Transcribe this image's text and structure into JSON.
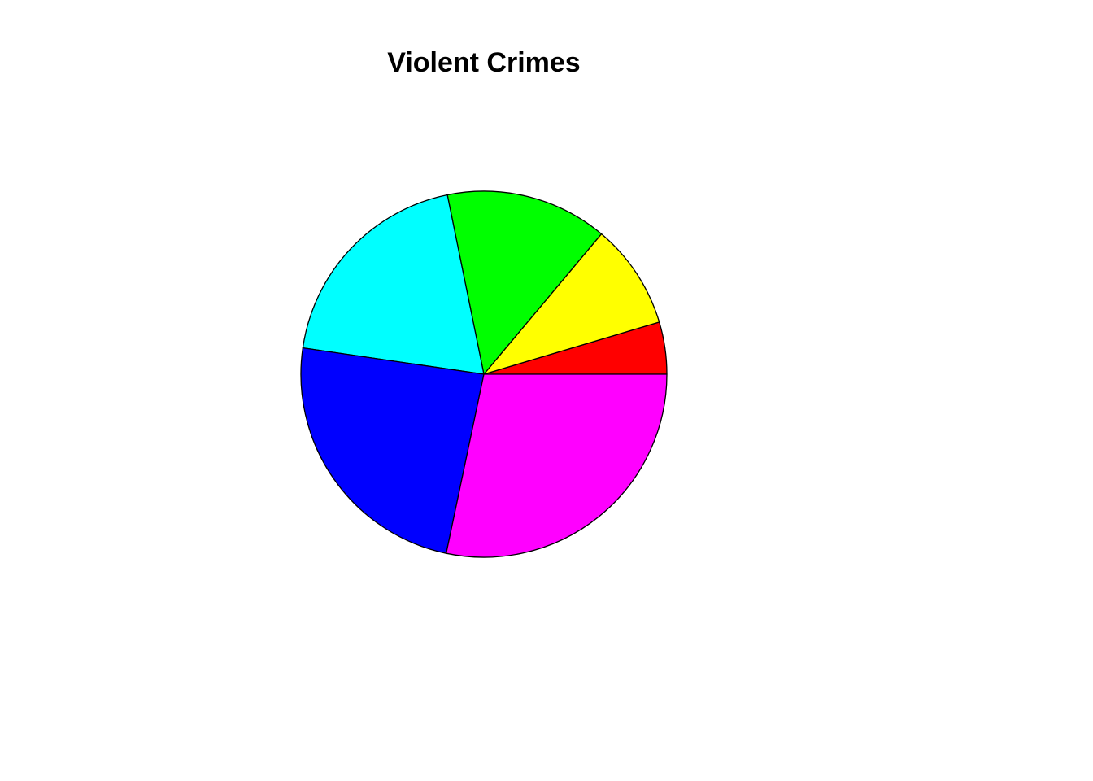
{
  "chart_data": {
    "type": "pie",
    "title": "Violent Crimes",
    "slices": [
      {
        "value": 4.6,
        "color": "#FF0000"
      },
      {
        "value": 9.3,
        "color": "#FFFF00"
      },
      {
        "value": 14.3,
        "color": "#00FF00"
      },
      {
        "value": 19.5,
        "color": "#00FFFF"
      },
      {
        "value": 24.0,
        "color": "#0000FF"
      },
      {
        "value": 28.3,
        "color": "#FF00FF"
      }
    ],
    "start_angle_deg": 0,
    "direction": "counterclockwise",
    "border_color": "#000000"
  }
}
